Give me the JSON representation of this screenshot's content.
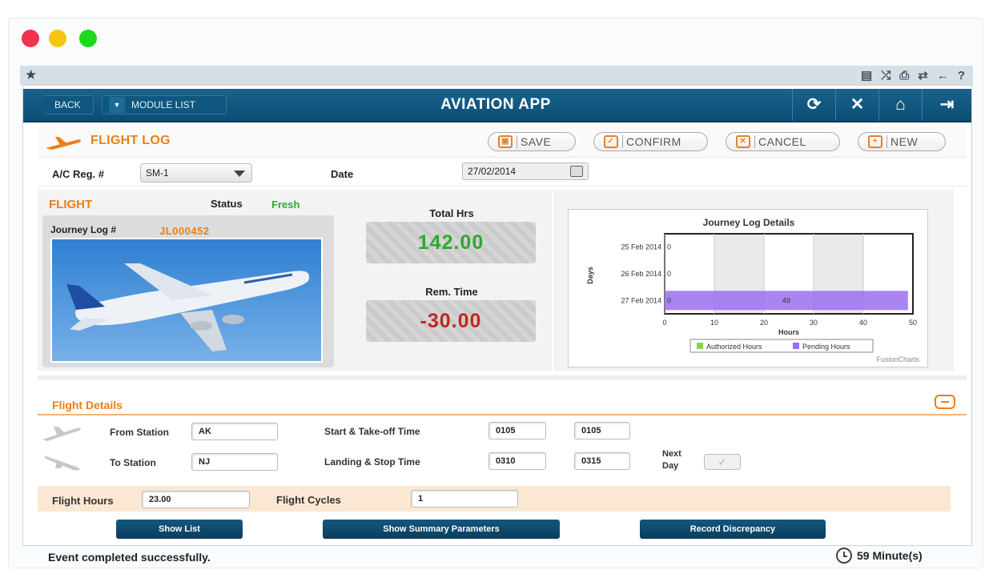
{
  "nav": {
    "back": "BACK",
    "module_list": "MODULE LIST",
    "title": "AVIATION APP"
  },
  "toolbar": {
    "title": "FLIGHT LOG",
    "save": "SAVE",
    "confirm": "CONFIRM",
    "cancel": "CANCEL",
    "new": "NEW"
  },
  "form": {
    "reg_label": "A/C Reg. #",
    "reg_value": "SM-1",
    "date_label": "Date",
    "date_value": "27/02/2014"
  },
  "flight": {
    "title": "FLIGHT",
    "status_label": "Status",
    "status_value": "Fresh",
    "journey_label": "Journey Log #",
    "journey_value": "JL000452"
  },
  "hours": {
    "total_label": "Total Hrs",
    "total_value": "142.00",
    "rem_label": "Rem. Time",
    "rem_value": "-30.00"
  },
  "chart_data": {
    "type": "bar",
    "orientation": "horizontal",
    "title": "Journey Log Details",
    "xlabel": "Hours",
    "ylabel": "Days",
    "categories": [
      "25 Feb 2014",
      "26 Feb 2014",
      "27 Feb 2014"
    ],
    "series": [
      {
        "name": "Authorized Hours",
        "values": [
          0,
          0,
          0
        ]
      },
      {
        "name": "Pending Hours",
        "values": [
          0,
          0,
          49
        ]
      }
    ],
    "data_labels": [
      "0",
      "0",
      "0",
      "49"
    ],
    "xlim": [
      0,
      50
    ],
    "xticks": [
      "0",
      "10",
      "20",
      "30",
      "40",
      "50"
    ],
    "legend": "bottom",
    "colors": {
      "authorized": "#8fd14f",
      "pending": "#9b6ef0"
    },
    "credit": "FusionCharts"
  },
  "details": {
    "title": "Flight Details",
    "from_label": "From Station",
    "from_value": "AK",
    "to_label": "To Station",
    "to_value": "NJ",
    "takeoff_label": "Start & Take-off Time",
    "takeoff_start": "0105",
    "takeoff_end": "0105",
    "landing_label": "Landing & Stop Time",
    "landing_start": "0310",
    "landing_end": "0315",
    "next_day_label_1": "Next",
    "next_day_label_2": "Day",
    "hours_label": "Flight Hours",
    "hours_value": "23.00",
    "cycles_label": "Flight Cycles",
    "cycles_value": "1"
  },
  "actions": {
    "show_list": "Show List",
    "summary": "Show Summary Parameters",
    "discrepancy": "Record Discrepancy"
  },
  "footer": {
    "message": "Event completed successfully.",
    "timer": "59 Minute(s)"
  }
}
